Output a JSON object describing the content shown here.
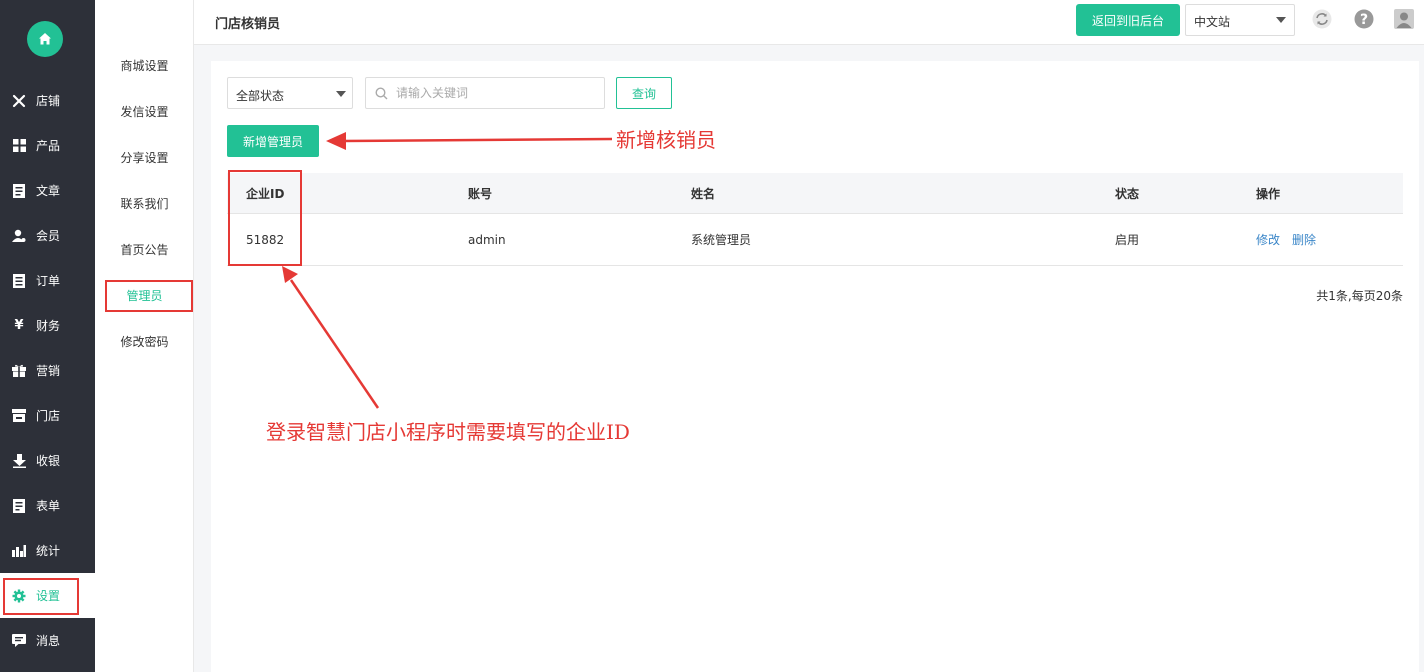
{
  "nav": {
    "items": [
      {
        "label": "店铺",
        "icon": "tools-icon",
        "glyph": "✕"
      },
      {
        "label": "产品",
        "icon": "grid-icon",
        "glyph": "▦"
      },
      {
        "label": "文章",
        "icon": "article-icon",
        "glyph": "▤"
      },
      {
        "label": "会员",
        "icon": "member-icon",
        "glyph": "♟"
      },
      {
        "label": "订单",
        "icon": "order-icon",
        "glyph": "▤"
      },
      {
        "label": "财务",
        "icon": "yen-icon",
        "glyph": "¥"
      },
      {
        "label": "营销",
        "icon": "gift-icon",
        "glyph": "▣"
      },
      {
        "label": "门店",
        "icon": "store-icon",
        "glyph": "▭"
      },
      {
        "label": "收银",
        "icon": "download-icon",
        "glyph": "⬇"
      },
      {
        "label": "表单",
        "icon": "form-icon",
        "glyph": "▤"
      },
      {
        "label": "统计",
        "icon": "chart-icon",
        "glyph": "▟"
      },
      {
        "label": "设置",
        "icon": "gear-icon",
        "glyph": "⚙"
      },
      {
        "label": "消息",
        "icon": "message-icon",
        "glyph": "▬"
      }
    ]
  },
  "submenu": {
    "items": [
      "商城设置",
      "发信设置",
      "分享设置",
      "联系我们",
      "首页公告",
      "管理员",
      "修改密码"
    ]
  },
  "header": {
    "title": "门店核销员",
    "back_button": "返回到旧后台",
    "language": "中文站"
  },
  "filters": {
    "status": "全部状态",
    "search_placeholder": "请输入关键词",
    "query_button": "查询"
  },
  "add_button": "新增管理员",
  "table": {
    "columns": [
      "企业ID",
      "账号",
      "姓名",
      "状态",
      "操作"
    ],
    "rows": [
      {
        "id": "51882",
        "account": "admin",
        "name": "系统管理员",
        "status": "启用",
        "edit": "修改",
        "delete": "删除"
      }
    ]
  },
  "pagination": "共1条,每页20条",
  "annotations": {
    "add_note": "新增核销员",
    "id_note": "登录智慧门店小程序时需要填写的企业ID"
  },
  "colors": {
    "accent": "#22c195",
    "sidebar": "#2d3039",
    "annotation": "#e53935",
    "link": "#3a86c8"
  }
}
